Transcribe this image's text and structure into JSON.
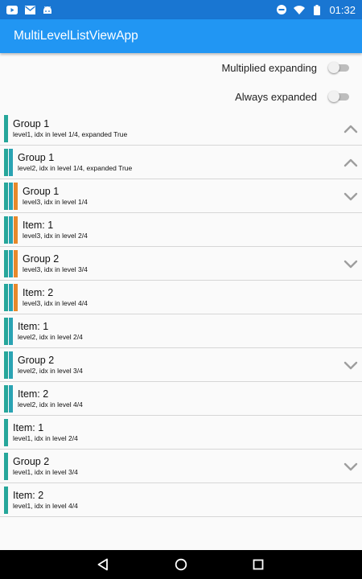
{
  "status_bar": {
    "time": "01:32"
  },
  "app_bar": {
    "title": "MultiLevelListViewApp"
  },
  "settings": [
    {
      "label": "Multiplied expanding",
      "checked": false
    },
    {
      "label": "Always expanded",
      "checked": false
    }
  ],
  "colors": {
    "level1": "#26a69a",
    "level2": "#2aa3b3",
    "level3": "#e8892b",
    "chevron": "#9e9e9e",
    "app_bar": "#2196f3"
  },
  "items": [
    {
      "title": "Group 1",
      "subtitle": "level1, idx in level 1/4, expanded True",
      "level": 1,
      "chevron": "up"
    },
    {
      "title": "Group 1",
      "subtitle": "level2, idx in level 1/4, expanded True",
      "level": 2,
      "chevron": "up"
    },
    {
      "title": "Group 1",
      "subtitle": "level3, idx in level 1/4",
      "level": 3,
      "chevron": "down"
    },
    {
      "title": "Item: 1",
      "subtitle": "level3, idx in level 2/4",
      "level": 3,
      "chevron": ""
    },
    {
      "title": "Group 2",
      "subtitle": "level3, idx in level 3/4",
      "level": 3,
      "chevron": "down"
    },
    {
      "title": "Item: 2",
      "subtitle": "level3, idx in level 4/4",
      "level": 3,
      "chevron": ""
    },
    {
      "title": "Item: 1",
      "subtitle": "level2, idx in level 2/4",
      "level": 2,
      "chevron": ""
    },
    {
      "title": "Group 2",
      "subtitle": "level2, idx in level 3/4",
      "level": 2,
      "chevron": "down"
    },
    {
      "title": "Item: 2",
      "subtitle": "level2, idx in level 4/4",
      "level": 2,
      "chevron": ""
    },
    {
      "title": "Item: 1",
      "subtitle": "level1, idx in level 2/4",
      "level": 1,
      "chevron": ""
    },
    {
      "title": "Group 2",
      "subtitle": "level1, idx in level 3/4",
      "level": 1,
      "chevron": "down"
    },
    {
      "title": "Item: 2",
      "subtitle": "level1, idx in level 4/4",
      "level": 1,
      "chevron": ""
    }
  ],
  "nav": {
    "back": "back-icon",
    "home": "home-icon",
    "recents": "recents-icon"
  }
}
